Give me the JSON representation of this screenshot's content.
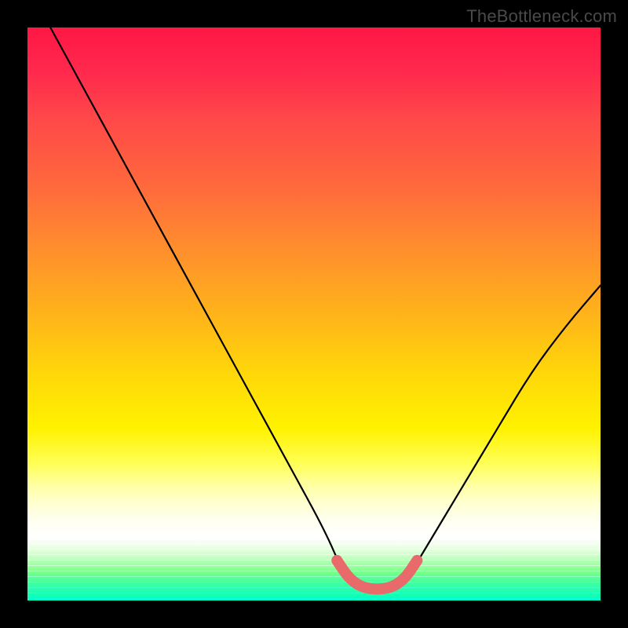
{
  "watermark": "TheBottleneck.com",
  "chart_data": {
    "type": "line",
    "title": "",
    "xlabel": "",
    "ylabel": "",
    "xlim": [
      0,
      100
    ],
    "ylim": [
      0,
      100
    ],
    "grid": false,
    "legend": false,
    "series": [
      {
        "name": "bottleneck-curve",
        "color": "#000000",
        "x": [
          4,
          10,
          16,
          22,
          28,
          34,
          40,
          46,
          52,
          55,
          58,
          61,
          64,
          67,
          70,
          76,
          82,
          88,
          94,
          100
        ],
        "values": [
          100,
          89,
          78,
          67,
          56,
          45,
          34,
          23,
          12,
          5,
          2,
          2,
          2,
          5,
          10,
          20,
          30,
          40,
          48,
          55
        ]
      },
      {
        "name": "bottleneck-flat-highlight",
        "color": "#e96a6a",
        "x": [
          54,
          56,
          58,
          60,
          62,
          64,
          66,
          68
        ],
        "values": [
          7,
          4,
          2.5,
          2,
          2,
          2.5,
          4,
          7
        ]
      }
    ],
    "colors": {
      "gradient_top": "#ff1744",
      "gradient_mid": "#ffd60a",
      "gradient_bottom": "#00ffc0",
      "highlight": "#e96a6a",
      "curve": "#000000",
      "frame": "#000000"
    }
  }
}
